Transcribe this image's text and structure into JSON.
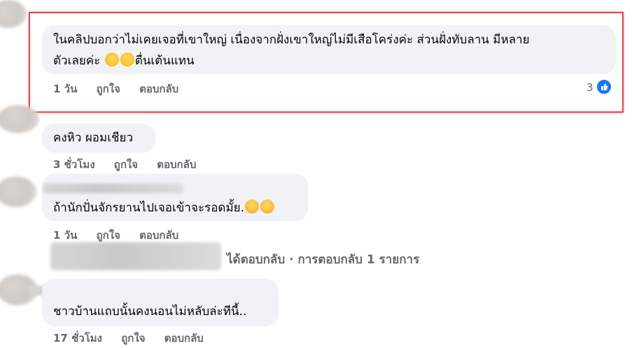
{
  "comments": [
    {
      "text_line1": "ในคลิปบอกว่าไม่เคยเจอที่เขาใหญ่ เนื่องจากฝั่งเขาใหญ่ไม่มีเสือโคร่งค่ะ ส่วนฝั่งทับลาน มีหลาย",
      "text_line2_before": "ตัวเลยค่ะ",
      "text_line2_after": "ตื่นเต้นแทน",
      "time": "1 วัน",
      "like_label": "ถูกใจ",
      "reply_label": "ตอบกลับ",
      "reaction_count": "3",
      "emojis": [
        "laughing-emoji",
        "laughing-emoji"
      ]
    },
    {
      "text": "คงหิว ผอมเชียว",
      "time": "3 ชั่วโมง",
      "like_label": "ถูกใจ",
      "reply_label": "ตอบกลับ"
    },
    {
      "text": "ถ้านักปั่นจักรยานไปเจอเข้าจะรอดมั้ย.",
      "time": "1 วัน",
      "like_label": "ถูกใจ",
      "reply_label": "ตอบกลับ",
      "emojis": [
        "crying-emoji",
        "crying-emoji"
      ]
    },
    {
      "text": "ชาวบ้านแถบนั้นคงนอนไม่หลับล่ะทีนี้..",
      "time": "17 ชั่วโมง",
      "like_label": "ถูกใจ",
      "reply_label": "ตอบกลับ"
    }
  ],
  "reply_summary": "ได้ตอบกลับ · การตอบกลับ 1 รายการ",
  "colors": {
    "bubble_bg": "#f0f2f5",
    "meta_text": "#65676b",
    "like_blue": "#1877f2",
    "highlight_red": "#e5484d"
  }
}
